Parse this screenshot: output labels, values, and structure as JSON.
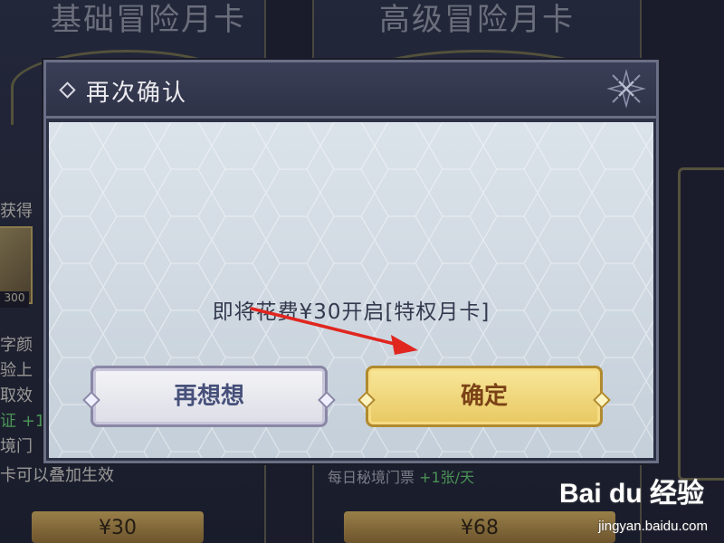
{
  "background": {
    "left_card_title": "基础冒险月卡",
    "right_card_title": "高级冒险月卡",
    "left_lines": [
      {
        "text": "获得",
        "green": false
      },
      {
        "text": "字颜",
        "green": false
      },
      {
        "text": "验上",
        "green": false
      },
      {
        "text": "取效",
        "green": false
      },
      {
        "text": "证 +1",
        "green": true
      },
      {
        "text": "境门",
        "green": false
      },
      {
        "text": "卡可以叠加生效",
        "green": false
      }
    ],
    "gem_count": "300",
    "left_price": "¥30",
    "right_price": "¥68",
    "right_footer": {
      "text": "每日秘境门票 ",
      "highlight": "+1张/天"
    }
  },
  "modal": {
    "title": "再次确认",
    "message": "即将花费¥30开启[特权月卡]",
    "cancel_label": "再想想",
    "confirm_label": "确定"
  },
  "watermark": {
    "logo": "Bai du 经验",
    "url": "jingyan.baidu.com"
  }
}
